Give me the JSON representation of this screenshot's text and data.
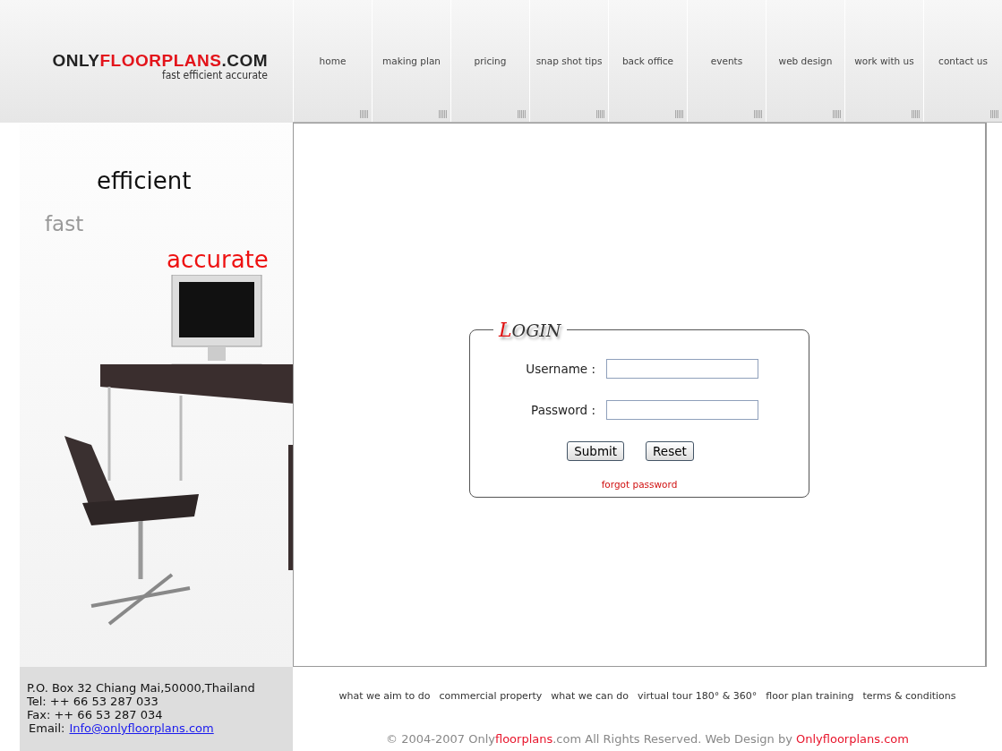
{
  "logo": {
    "parts": [
      {
        "text": "ONLY",
        "highlight": false
      },
      {
        "text": "FLOORPLANS",
        "highlight": true
      },
      {
        "text": ".COM",
        "highlight": false
      }
    ],
    "tagline": "fast efficient accurate"
  },
  "nav": [
    {
      "label": "home"
    },
    {
      "label": "making plan"
    },
    {
      "label": "pricing"
    },
    {
      "label": "snap shot tips"
    },
    {
      "label": "back office"
    },
    {
      "label": "events"
    },
    {
      "label": "web design"
    },
    {
      "label": "work with us"
    },
    {
      "label": "contact us"
    }
  ],
  "promo": {
    "words": [
      {
        "text": "efficient",
        "kind": "dark"
      },
      {
        "text": "fast",
        "kind": "grey"
      },
      {
        "text": "accurate",
        "kind": "red"
      }
    ]
  },
  "login": {
    "title": "LOGIN",
    "fields": [
      {
        "label": "Username :"
      },
      {
        "label": "Password :"
      }
    ],
    "buttons": [
      "Submit",
      "Reset"
    ],
    "forgot": "forgot password"
  },
  "contact": {
    "lines": [
      "P.O. Box 32 Chiang Mai,50000,Thailand",
      "Tel: ++ 66 53 287 033",
      "Fax: ++ 66 53 287 034"
    ],
    "email_label": "Email:",
    "email": "Info@onlyfloorplans.com"
  },
  "footer_links": [
    "what we aim to do",
    "commercial property",
    "what we can do",
    "virtual tour 180° & 360°",
    "floor plan training",
    "terms & conditions"
  ],
  "copyright": [
    {
      "text": "© 2004-2007 Only",
      "highlight": false
    },
    {
      "text": "floorplans",
      "highlight": true
    },
    {
      "text": ".com All Rights Reserved. Web Design by ",
      "highlight": false
    },
    {
      "text": "Onlyfloorplans.com",
      "highlight": true
    }
  ]
}
